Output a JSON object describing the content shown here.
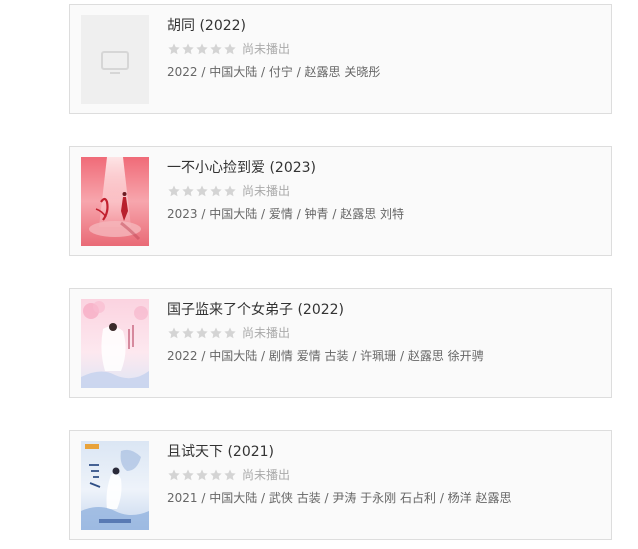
{
  "items": [
    {
      "title": "胡同 (2022)",
      "status": "尚未播出",
      "meta": "2022 / 中国大陆 / 付宁 / 赵露思 关晓彤",
      "poster": "placeholder"
    },
    {
      "title": "一不小心捡到爱 (2023)",
      "status": "尚未播出",
      "meta": "2023 / 中国大陆 / 爱情 / 钟青 / 赵露思 刘特",
      "poster": "pink"
    },
    {
      "title": "国子监来了个女弟子 (2022)",
      "status": "尚未播出",
      "meta": "2022 / 中国大陆 / 剧情 爱情 古装 / 许珮珊 / 赵露思 徐开骋",
      "poster": "lightpink"
    },
    {
      "title": "且试天下 (2021)",
      "status": "尚未播出",
      "meta": "2021 / 中国大陆 / 武侠 古装 / 尹涛 于永刚 石占利 / 杨洋 赵露思",
      "poster": "blue"
    }
  ],
  "colors": {
    "star_empty": "#d4d4d4",
    "status_text": "#aaaaaa",
    "meta_text": "#666666",
    "title_text": "#333333",
    "card_border": "#dddddd",
    "card_bg": "#fafafa"
  }
}
